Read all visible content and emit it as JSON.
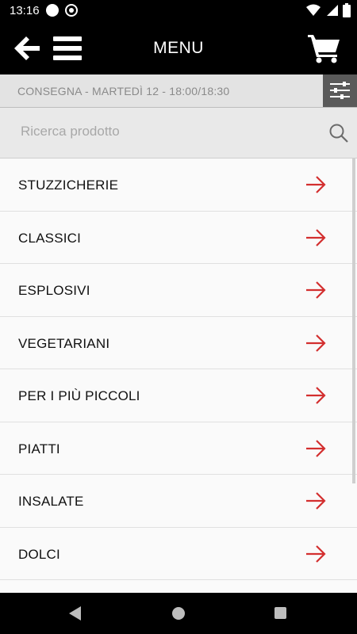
{
  "status_bar": {
    "time": "13:16"
  },
  "app_bar": {
    "title": "MENU",
    "back_icon": "arrow-left-icon",
    "menu_icon": "hamburger-icon",
    "cart_icon": "cart-icon"
  },
  "delivery": {
    "text": "CONSEGNA - MARTEDÌ 12 - 18:00/18:30",
    "filter_icon": "sliders-icon"
  },
  "search": {
    "placeholder": "Ricerca prodotto",
    "value": "",
    "icon": "search-icon"
  },
  "categories": [
    {
      "label": "STUZZICHERIE"
    },
    {
      "label": "CLASSICI"
    },
    {
      "label": "ESPLOSIVI"
    },
    {
      "label": "VEGETARIANI"
    },
    {
      "label": "PER I PIÙ PICCOLI"
    },
    {
      "label": "PIATTI"
    },
    {
      "label": "INSALATE"
    },
    {
      "label": "DOLCI"
    }
  ],
  "colors": {
    "accent_arrow": "#d32f2f",
    "header_bg": "#000000",
    "filter_btn_bg": "#5a5a5a"
  }
}
